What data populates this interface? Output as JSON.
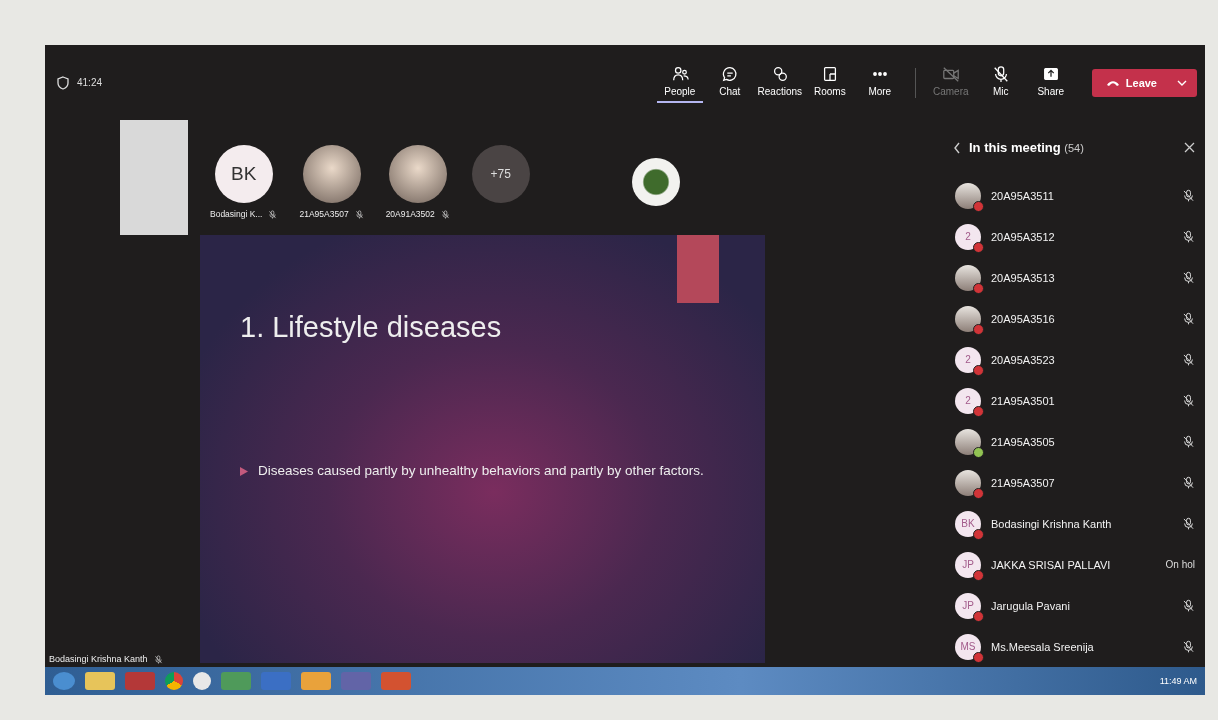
{
  "meeting_timer": "41:24",
  "toolbar": [
    {
      "kind": "people",
      "label": "People",
      "selected": true,
      "disabled": false
    },
    {
      "kind": "chat",
      "label": "Chat",
      "selected": false,
      "disabled": false
    },
    {
      "kind": "reactions",
      "label": "Reactions",
      "selected": false,
      "disabled": false
    },
    {
      "kind": "rooms",
      "label": "Rooms",
      "selected": false,
      "disabled": false
    },
    {
      "kind": "more",
      "label": "More",
      "selected": false,
      "disabled": false
    },
    {
      "kind": "camera",
      "label": "Camera",
      "selected": false,
      "disabled": true
    },
    {
      "kind": "mic",
      "label": "Mic",
      "selected": false,
      "disabled": false
    },
    {
      "kind": "share",
      "label": "Share",
      "selected": false,
      "disabled": false
    }
  ],
  "leave_button": {
    "label": "Leave"
  },
  "gallery": [
    {
      "kind": "video"
    },
    {
      "kind": "initials",
      "initials": "BK",
      "name": "Bodasingi K..."
    },
    {
      "kind": "photo",
      "name": "21A95A3507"
    },
    {
      "kind": "photo",
      "name": "20A91A3502"
    },
    {
      "kind": "overflow",
      "count": "+75"
    }
  ],
  "pinned_avatar": {
    "kind": "photo"
  },
  "slide": {
    "title": "1. Lifestyle diseases",
    "bullets": [
      "Diseases caused partly by unhealthy behaviors and partly by other factors."
    ]
  },
  "presenter": {
    "name": "Bodasingi Krishna Kanth"
  },
  "panel": {
    "title": "In this meeting",
    "count": "(54)",
    "participants": [
      {
        "name": "20A95A3511",
        "kind": "photo",
        "color": "#d13438",
        "muted": true
      },
      {
        "name": "20A95A3512",
        "kind": "initials",
        "initials": "2",
        "color": "#d13438",
        "muted": true
      },
      {
        "name": "20A95A3513",
        "kind": "photo",
        "color": "#d13438",
        "muted": true
      },
      {
        "name": "20A95A3516",
        "kind": "photo",
        "color": "#d13438",
        "muted": true
      },
      {
        "name": "20A95A3523",
        "kind": "initials",
        "initials": "2",
        "color": "#d13438",
        "muted": true
      },
      {
        "name": "21A95A3501",
        "kind": "initials",
        "initials": "2",
        "color": "#d13438",
        "muted": true
      },
      {
        "name": "21A95A3505",
        "kind": "photo",
        "color": "#92c353",
        "muted": true
      },
      {
        "name": "21A95A3507",
        "kind": "photo",
        "color": "#d13438",
        "muted": true
      },
      {
        "name": "Bodasingi Krishna Kanth",
        "kind": "initials",
        "initials": "BK",
        "color": "#d13438",
        "muted": true
      },
      {
        "name": "JAKKA SRISAI PALLAVI",
        "kind": "initials",
        "initials": "JP",
        "color": "#d13438",
        "muted": false,
        "note": "On hol"
      },
      {
        "name": "Jarugula Pavani",
        "kind": "initials",
        "initials": "JP",
        "color": "#d13438",
        "muted": true
      },
      {
        "name": "Ms.Meesala Sreenija",
        "kind": "initials",
        "initials": "MS",
        "color": "#d13438",
        "muted": true
      }
    ]
  },
  "taskbar": {
    "clock": "11:49 AM"
  }
}
